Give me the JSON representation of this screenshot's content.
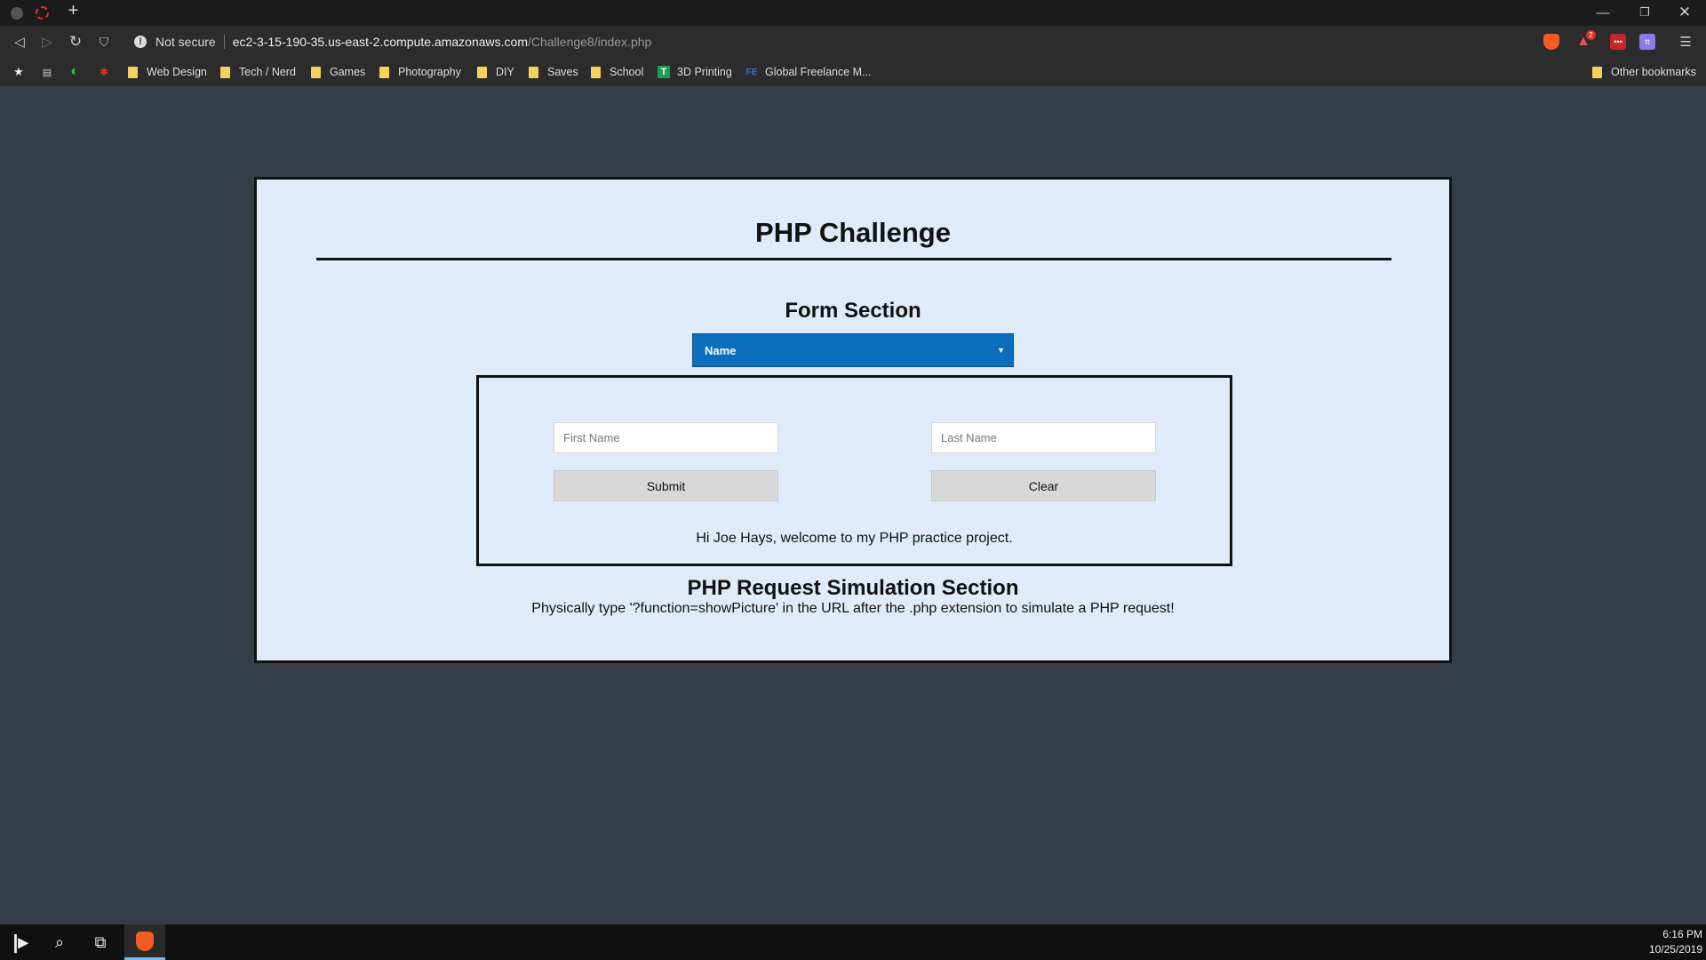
{
  "browser": {
    "security_label": "Not secure",
    "url_host": "ec2-3-15-190-35.us-east-2.compute.amazonaws.com",
    "url_path": "/Challenge8/index.php",
    "extensions": {
      "rewards_badge": "2",
      "lastpass_label": "•••",
      "twitch_label": "tt"
    },
    "bookmarks": [
      {
        "label": "Web Design"
      },
      {
        "label": "Tech / Nerd"
      },
      {
        "label": "Games"
      },
      {
        "label": "Photography"
      },
      {
        "label": "DIY"
      },
      {
        "label": "Saves"
      },
      {
        "label": "School"
      },
      {
        "label": "3D Printing"
      },
      {
        "label": "Global Freelance M..."
      }
    ],
    "other_bookmarks": "Other bookmarks"
  },
  "page": {
    "title": "PHP Challenge",
    "form_heading": "Form Section",
    "select_value": "Name",
    "first_name_placeholder": "First Name",
    "last_name_placeholder": "Last Name",
    "submit_label": "Submit",
    "clear_label": "Clear",
    "welcome_message": "Hi Joe Hays, welcome to my PHP practice project.",
    "simulation_heading": "PHP Request Simulation Section",
    "simulation_text": "Physically type '?function=showPicture' in the URL after the .php extension to simulate a PHP request!"
  },
  "taskbar": {
    "time": "6:16 PM",
    "date": "10/25/2019"
  },
  "colors": {
    "page_background": "#353e48",
    "card_background": "#dfebf8",
    "select_background": "#0a6ebd",
    "button_background": "#d8d8d8"
  }
}
